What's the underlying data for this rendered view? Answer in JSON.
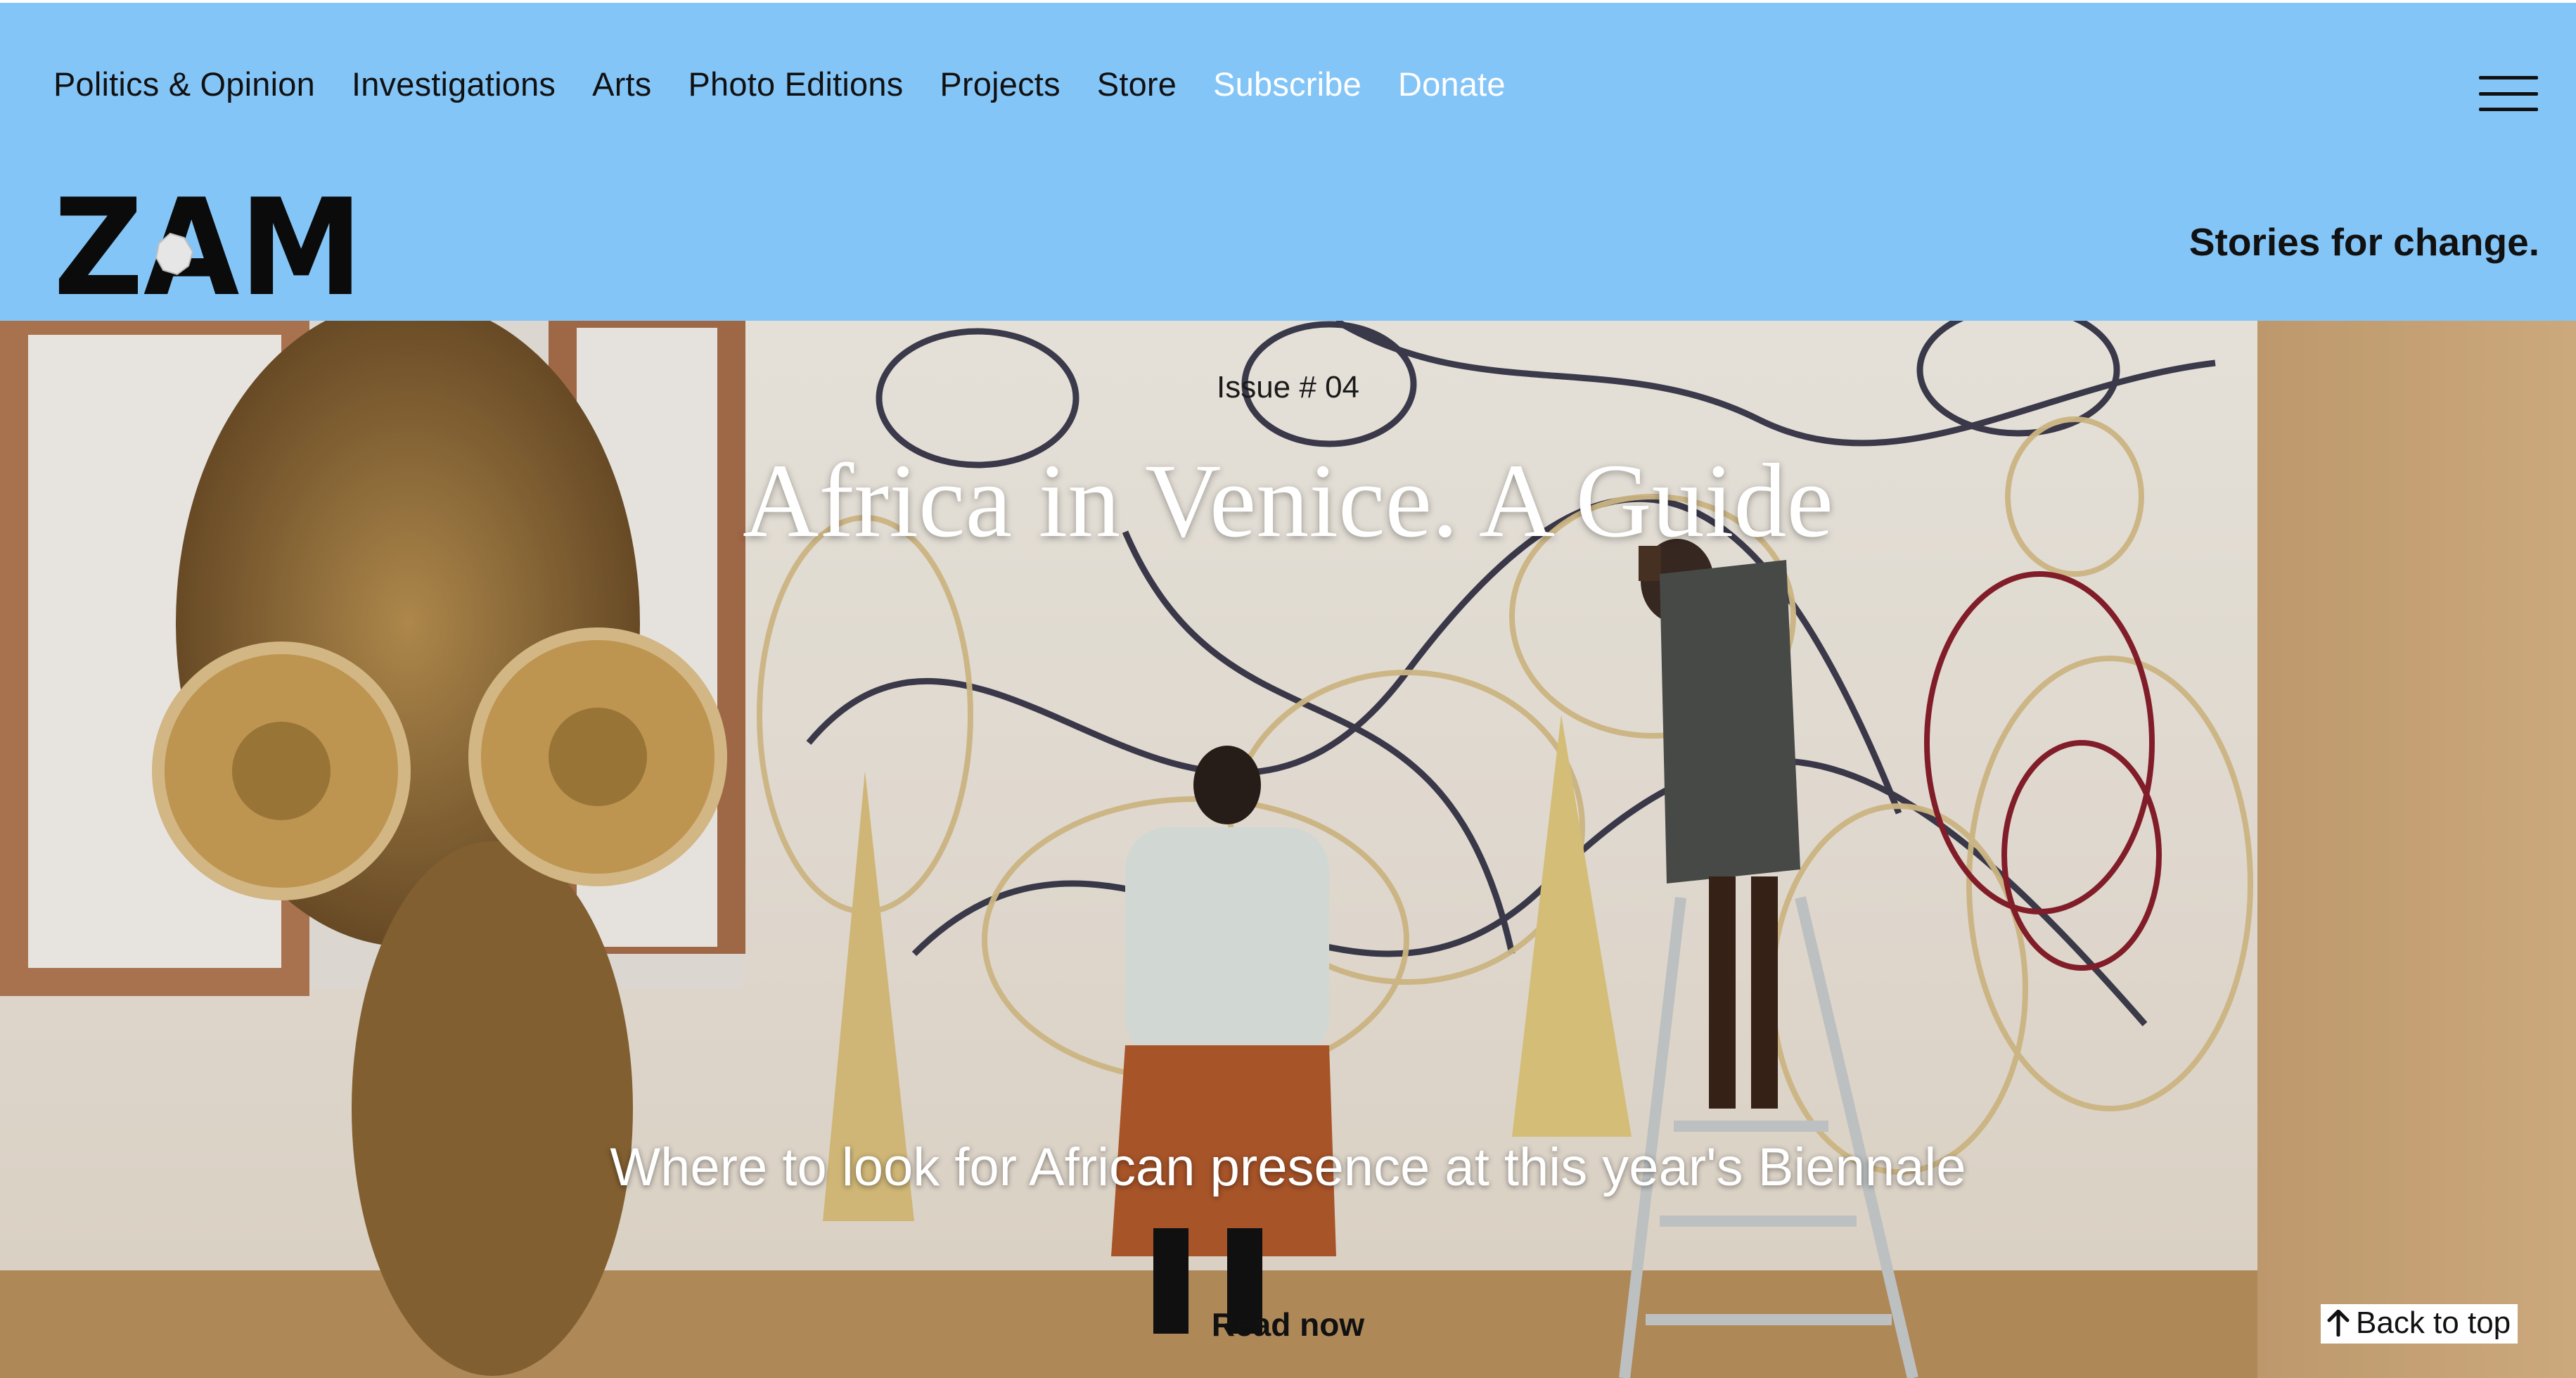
{
  "nav": {
    "items": [
      {
        "label": "Politics & Opinion"
      },
      {
        "label": "Investigations"
      },
      {
        "label": "Arts"
      },
      {
        "label": "Photo Editions"
      },
      {
        "label": "Projects"
      },
      {
        "label": "Store"
      },
      {
        "label": "Subscribe"
      },
      {
        "label": "Donate"
      }
    ],
    "menu_icon": "hamburger-menu-icon"
  },
  "brand": {
    "logo_text": "ZAM",
    "tagline": "Stories for change."
  },
  "hero": {
    "issue": "Issue # 04",
    "title": "Africa in Venice. A Guide",
    "subtitle": "Where to look for African presence at this year's Biennale",
    "cta": "Read now"
  },
  "footer_controls": {
    "back_to_top": "Back to top",
    "back_to_top_icon": "arrow-up-icon"
  },
  "colors": {
    "header_bg": "#84c5f8",
    "text_dark": "#111111",
    "nav_highlight": "#ffffff"
  }
}
